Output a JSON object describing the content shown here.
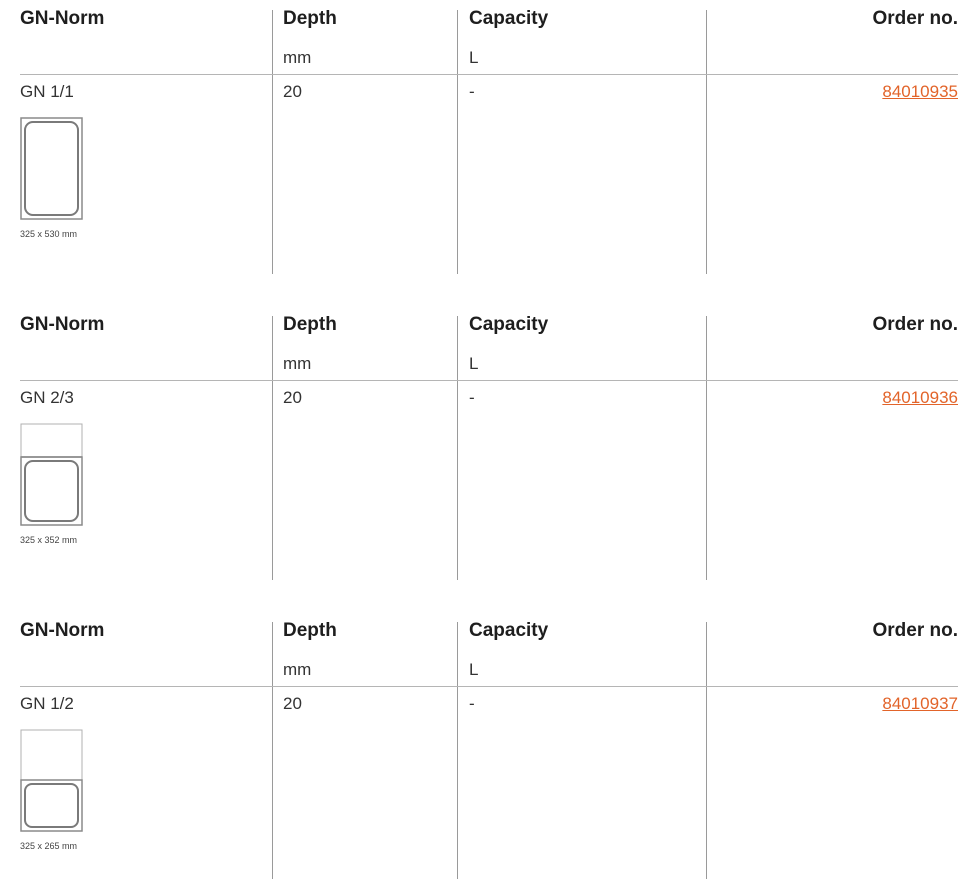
{
  "tables": [
    {
      "headers": {
        "norm": "GN-Norm",
        "depth": "Depth",
        "capacity": "Capacity",
        "order": "Order no."
      },
      "units": {
        "depth": "mm",
        "capacity": "L"
      },
      "row": {
        "norm": "GN 1/1",
        "depth": "20",
        "capacity": "-",
        "order_no": "84010935"
      },
      "figure": {
        "caption": "325 x 530 mm",
        "fill_fraction": 1.0
      }
    },
    {
      "headers": {
        "norm": "GN-Norm",
        "depth": "Depth",
        "capacity": "Capacity",
        "order": "Order no."
      },
      "units": {
        "depth": "mm",
        "capacity": "L"
      },
      "row": {
        "norm": "GN 2/3",
        "depth": "20",
        "capacity": "-",
        "order_no": "84010936"
      },
      "figure": {
        "caption": "325 x 352 mm",
        "fill_fraction": 0.667
      }
    },
    {
      "headers": {
        "norm": "GN-Norm",
        "depth": "Depth",
        "capacity": "Capacity",
        "order": "Order no."
      },
      "units": {
        "depth": "mm",
        "capacity": "L"
      },
      "row": {
        "norm": "GN 1/2",
        "depth": "20",
        "capacity": "-",
        "order_no": "84010937"
      },
      "figure": {
        "caption": "325 x 265 mm",
        "fill_fraction": 0.5
      }
    }
  ],
  "colors": {
    "link": "#e2642a",
    "rule": "#b5b5b5",
    "outline": "#8a8a8a"
  }
}
